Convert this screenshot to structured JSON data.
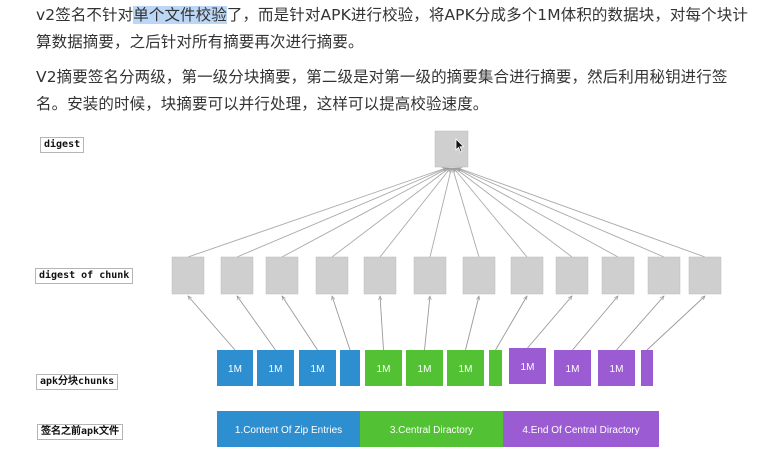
{
  "paragraphs": {
    "p1_before": "v2签名不针对",
    "p1_highlight": "单个文件校验",
    "p1_after": "了，而是针对APK进行校验，将APK分成多个1M体积的数据块，对每个块计算数据摘要，之后针对所有摘要再次进行摘要。",
    "p2": "V2摘要签名分两级，第一级分块摘要，第二级是对第一级的摘要集合进行摘要，然后利用秘钥进行签名。安装的时候，块摘要可以并行处理，这样可以提高校验速度。"
  },
  "labels": {
    "digest": "digest",
    "digest_of_chunk": "digest of chunk",
    "apk_chunks": "apk分块chunks",
    "apk_file": "签名之前apk文件"
  },
  "colors": {
    "blue": "#2e8fd0",
    "green": "#52c234",
    "purple": "#9b5bd3",
    "gray_box": "#cfcfcf"
  },
  "chunks": [
    {
      "label": "1M",
      "color": "blue"
    },
    {
      "label": "1M",
      "color": "blue"
    },
    {
      "label": "1M",
      "color": "blue"
    },
    {
      "label": "",
      "color": "blue"
    },
    {
      "label": "1M",
      "color": "green"
    },
    {
      "label": "1M",
      "color": "green"
    },
    {
      "label": "1M",
      "color": "green"
    },
    {
      "label": "",
      "color": "green"
    },
    {
      "label": "1M",
      "color": "purple"
    },
    {
      "label": "1M",
      "color": "purple"
    },
    {
      "label": "1M",
      "color": "purple"
    },
    {
      "label": "",
      "color": "purple"
    }
  ],
  "file_sections": [
    {
      "label": "1.Content Of Zip Entries",
      "color": "blue"
    },
    {
      "label": "3.Central Diractory",
      "color": "green"
    },
    {
      "label": "4.End Of Central Diractory",
      "color": "purple"
    }
  ],
  "cursor_icon": "arrow-cursor-icon"
}
